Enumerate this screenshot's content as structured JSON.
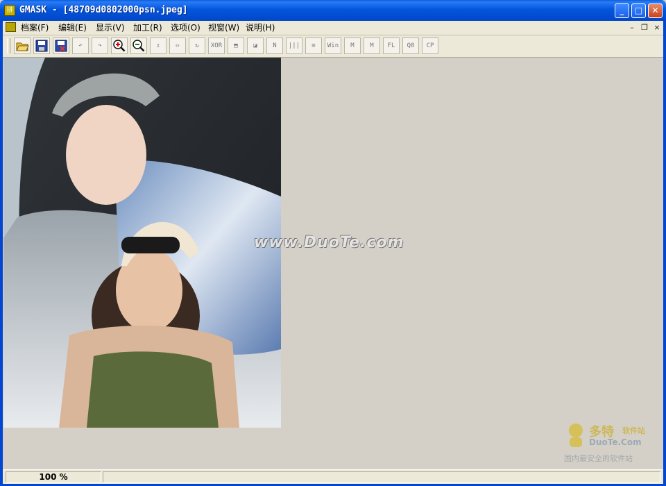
{
  "window": {
    "app_name": "GMASK",
    "title": "GMASK - [48709d0802000psn.jpeg]",
    "minimize_symbol": "_",
    "maximize_symbol": "□",
    "close_symbol": "✕"
  },
  "menu": {
    "items": [
      {
        "label": "档案(F)"
      },
      {
        "label": "编辑(E)"
      },
      {
        "label": "显示(V)"
      },
      {
        "label": "加工(R)"
      },
      {
        "label": "选项(O)"
      },
      {
        "label": "视窗(W)"
      },
      {
        "label": "说明(H)"
      }
    ],
    "mdi_minimize": "–",
    "mdi_restore": "❐",
    "mdi_close": "×"
  },
  "toolbar": {
    "buttons": [
      {
        "icon": "open-folder-icon",
        "text": ""
      },
      {
        "icon": "save-icon",
        "text": ""
      },
      {
        "icon": "save-as-icon",
        "text": ""
      },
      {
        "icon": "undo-icon",
        "text": "↶"
      },
      {
        "icon": "redo-icon",
        "text": "↷"
      },
      {
        "icon": "zoom-in-icon",
        "text": ""
      },
      {
        "icon": "zoom-out-icon",
        "text": ""
      },
      {
        "icon": "flip-vertical-icon",
        "text": "⇕"
      },
      {
        "icon": "flip-horizontal-icon",
        "text": "⇔"
      },
      {
        "icon": "rotate-icon",
        "text": "↻"
      },
      {
        "icon": "xor-icon",
        "text": "XOR"
      },
      {
        "icon": "negative-icon",
        "text": "⬒"
      },
      {
        "icon": "effect-icon",
        "text": "◪"
      },
      {
        "icon": "nega-icon",
        "text": "N"
      },
      {
        "icon": "vertical-lines-icon",
        "text": "|||"
      },
      {
        "icon": "horizontal-lines-icon",
        "text": "≡"
      },
      {
        "icon": "win-icon",
        "text": "Win"
      },
      {
        "icon": "meko-icon",
        "text": "M"
      },
      {
        "icon": "meko-alt-icon",
        "text": "M"
      },
      {
        "icon": "fl-icon",
        "text": "FL"
      },
      {
        "icon": "q0-icon",
        "text": "Q0"
      },
      {
        "icon": "cp-icon",
        "text": "CP"
      }
    ]
  },
  "canvas": {
    "watermark": "www.DuoTe.com"
  },
  "corner_logo": {
    "name_big": "多特",
    "name_small": "软件站",
    "domain": "DuoTe.Com",
    "slogan": "国内最安全的软件站"
  },
  "status": {
    "zoom": "100 %"
  },
  "colors": {
    "titlebar": "#0355de",
    "chrome": "#ece9d8",
    "workspace": "#d4d0c8"
  }
}
